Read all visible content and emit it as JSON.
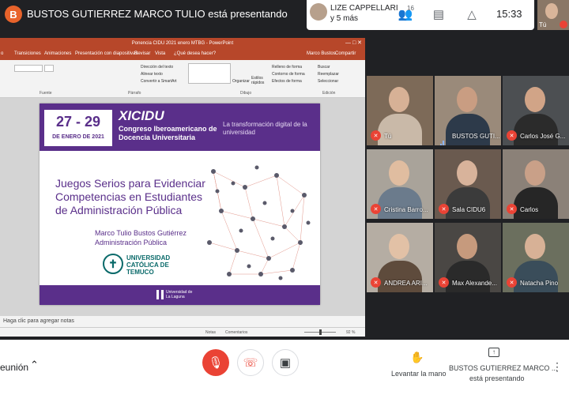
{
  "topbar": {
    "presenter_initial": "B",
    "presenter_text": "BUSTOS GUTIERREZ MARCO TULIO está presentando",
    "featured_name_line1": "LIZE CAPPELLARI",
    "featured_name_line2": "y 5 más",
    "people_count": "16",
    "time": "15:33",
    "self_label": "Tú"
  },
  "powerpoint": {
    "window_title": "Ponencia CIDU 2021 enero MTBG - PowerPoint",
    "user": "Marco Bustos",
    "share": "Compartir",
    "tabs": [
      "o",
      "Transiciones",
      "Animaciones",
      "Presentación con diapositivas",
      "Revisar",
      "Vista",
      "¿Qué desea hacer?"
    ],
    "ribbon": {
      "group_font": "Fuente",
      "group_paragraph": "Párrafo",
      "group_drawing": "Dibujo",
      "group_edit": "Edición",
      "direction": "Dirección del texto",
      "align": "Alinear texto",
      "smartart": "Convertir a SmartArt",
      "organize": "Organizar",
      "quick_styles": "Estilos rápidos",
      "fill": "Relleno de forma",
      "outline": "Contorno de forma",
      "effects": "Efectos de forma",
      "find": "Buscar",
      "replace": "Reemplazar",
      "select": "Seleccionar"
    },
    "slide": {
      "date_big": "27 - 29",
      "date_small": "DE ENERO DE 2021",
      "cidu": "XICIDU",
      "cidu_sub": "Congreso Iberoamericano de Docencia Universitaria",
      "tagline": "La transformación digital de la universidad",
      "talk_title": "Juegos Serios para Evidenciar Competencias en Estudiantes de Administración Pública",
      "author": "Marco Tulio Bustos Gutiérrez",
      "author_role": "Administración Pública",
      "uni_name": "UNIVERSIDAD CATÓLICA DE TEMUCO",
      "footer_uni": "Universidad de La Laguna"
    },
    "notes_placeholder": "Haga clic para agregar notas",
    "status": {
      "notes": "Notas",
      "comments": "Comentarios",
      "zoom": "92 %"
    }
  },
  "participants": [
    {
      "name": "Tú",
      "muted": true,
      "bg": "#7d6a58",
      "skin": "#d7b196",
      "shirt": "#c9b9a8"
    },
    {
      "name": "BUSTOS GUTI...",
      "muted": false,
      "bg": "#9a8a7a",
      "skin": "#c99d82",
      "shirt": "#2d3a4a"
    },
    {
      "name": "Carlos José G...",
      "muted": true,
      "bg": "#4c4f52",
      "skin": "#d1a487",
      "shirt": "#2b2b2b"
    },
    {
      "name": "Cristina Barro...",
      "muted": true,
      "bg": "#a9a39a",
      "skin": "#e0bda0",
      "shirt": "#6b7b8c"
    },
    {
      "name": "Sala CIDU6",
      "muted": true,
      "bg": "#6a5a4f",
      "skin": "#d8b39b",
      "shirt": "#3b3b3b"
    },
    {
      "name": "Carlos",
      "muted": true,
      "bg": "#8b8178",
      "skin": "#c9a088",
      "shirt": "#262626"
    },
    {
      "name": "ANDREA ARI...",
      "muted": true,
      "bg": "#b5ada3",
      "skin": "#e2c1a6",
      "shirt": "#5e4b3c"
    },
    {
      "name": "Max Alexande...",
      "muted": true,
      "bg": "#4a4744",
      "skin": "#c69a7d",
      "shirt": "#2a2a2a"
    },
    {
      "name": "Natacha Pino",
      "muted": true,
      "bg": "#6b6f5e",
      "skin": "#d7b196",
      "shirt": "#3a4d5a"
    }
  ],
  "bottombar": {
    "meeting_label": "eunión",
    "raise_hand": "Levantar la mano",
    "presenting_name": "BUSTOS GUTIERREZ MARCO ...",
    "presenting_status": "está presentando"
  },
  "colors": {
    "accent_red": "#ea4335",
    "ppt_red": "#b7472a",
    "cidu_purple": "#5a2f8a"
  }
}
